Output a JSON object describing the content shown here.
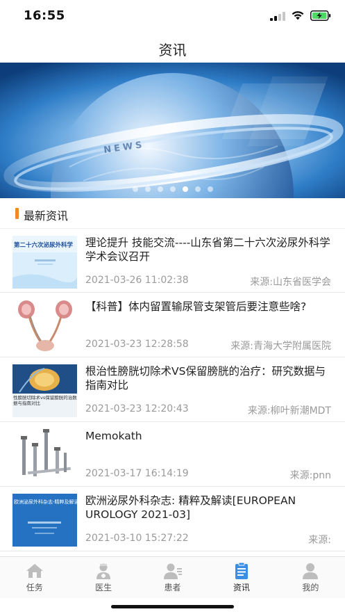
{
  "status_bar": {
    "time": "16:55",
    "icons": [
      "signal-icon",
      "wifi-icon",
      "battery-charging-icon"
    ],
    "battery_color": "#4cd964"
  },
  "nav": {
    "title": "资讯"
  },
  "banner": {
    "slide_count": 7,
    "active_slide": 4,
    "banner_text": "NEWS"
  },
  "section": {
    "title": "最新资讯",
    "accent_color": "#f08a24"
  },
  "news": [
    {
      "title": "理论提升 技能交流----山东省第二十六次泌尿外科学学术会议召开",
      "date": "2021-03-26 11:02:38",
      "source": "来源:山东省医学会",
      "thumb_caption": "第二十六次泌尿外科学"
    },
    {
      "title": "【科普】体内留置输尿管支架管后要注意些啥?",
      "date": "2021-03-23 12:28:58",
      "source": "来源:青海大学附属医院",
      "thumb_caption": ""
    },
    {
      "title": "根治性膀胱切除术VS保留膀胱的治疗：研究数据与指南对比",
      "date": "2021-03-23 12:20:43",
      "source": "来源:柳叶新潮MDT",
      "thumb_caption": "性膀胱切除术vs保留膀胱的治数据与指南对比"
    },
    {
      "title": "Memokath",
      "date": "2021-03-17 16:14:19",
      "source": "来源:pnn",
      "thumb_caption": ""
    },
    {
      "title": "欧洲泌尿外科杂志: 精粹及解读[EUROPEAN UROLOGY 2021-03]",
      "date": "2021-03-10 15:27:22",
      "source": "来源:",
      "thumb_caption": "欧洲泌尿外科杂志-精粹及解读"
    }
  ],
  "tabs": [
    {
      "label": "任务",
      "icon": "home-icon",
      "active": false
    },
    {
      "label": "医生",
      "icon": "doctor-icon",
      "active": false
    },
    {
      "label": "患者",
      "icon": "patient-icon",
      "active": false
    },
    {
      "label": "资讯",
      "icon": "news-icon",
      "active": true
    },
    {
      "label": "我的",
      "icon": "profile-icon",
      "active": false
    }
  ],
  "colors": {
    "tab_inactive": "#bdbdbd",
    "tab_active": "#3a8ee6"
  }
}
